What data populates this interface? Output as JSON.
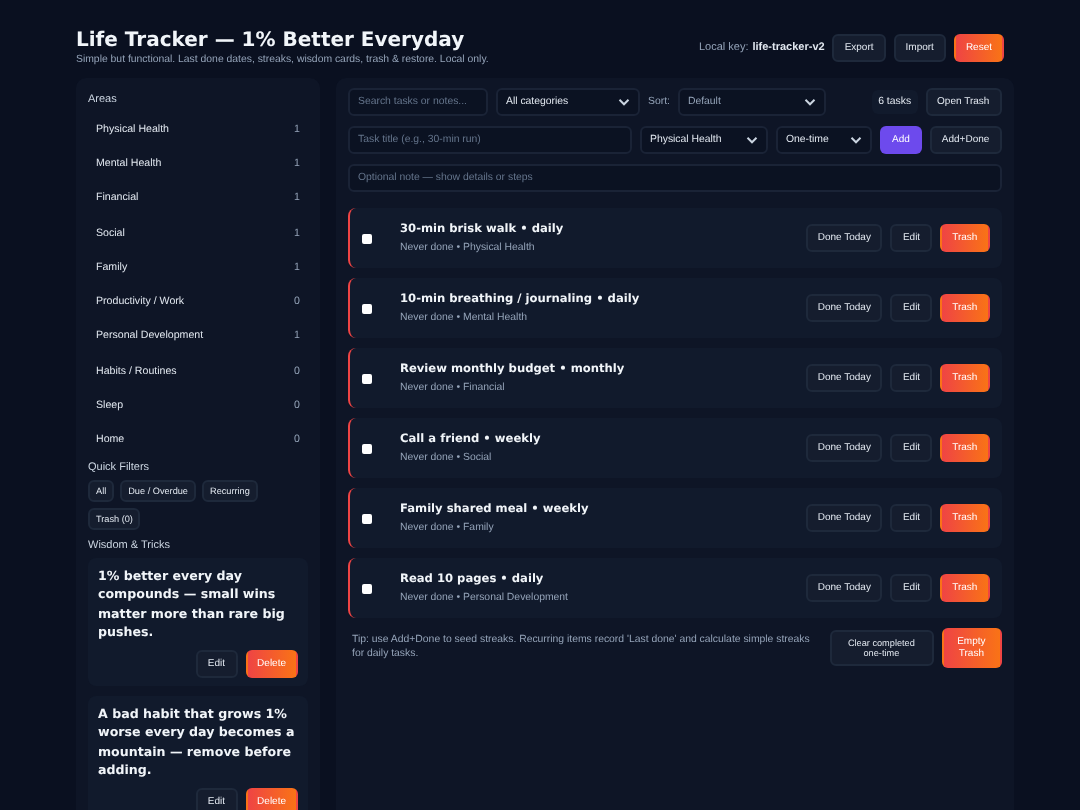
{
  "header": {
    "title": "Life Tracker — 1% Better Everyday",
    "subtitle": "Simple but functional. Last done dates, streaks, wisdom cards, trash & restore. Local only.",
    "key_label": "Local key:",
    "key_value": "life-tracker-v2",
    "buttons": [
      {
        "label": "Export",
        "kind": "plain"
      },
      {
        "label": "Import",
        "kind": "plain"
      },
      {
        "label": "Reset",
        "kind": "danger"
      }
    ]
  },
  "areas": {
    "title": "Areas",
    "items": [
      {
        "name": "Physical Health",
        "count": "1"
      },
      {
        "name": "Mental Health",
        "count": "1"
      },
      {
        "name": "Financial",
        "count": "1"
      },
      {
        "name": "Social",
        "count": "1"
      },
      {
        "name": "Family",
        "count": "1"
      },
      {
        "name": "Productivity / Work",
        "count": "0"
      },
      {
        "name": "Personal Development",
        "count": "1"
      },
      {
        "name": "Habits / Routines",
        "count": "0"
      },
      {
        "name": "Sleep",
        "count": "0"
      },
      {
        "name": "Home",
        "count": "0"
      }
    ]
  },
  "quick_filters": {
    "title": "Quick Filters",
    "items": [
      "All",
      "Due / Overdue",
      "Recurring",
      "Trash (0)"
    ]
  },
  "wisdom": {
    "title": "Wisdom & Tricks",
    "cards": [
      {
        "text": "1% better every day compounds — small wins matter more than rare big pushes.",
        "edit": "Edit",
        "delete": "Delete"
      },
      {
        "text": "A bad habit that grows 1% worse every day becomes a mountain — remove before adding.",
        "edit": "Edit",
        "delete": "Delete"
      }
    ]
  },
  "toolbar": {
    "search_placeholder": "Search tasks or notes...",
    "category": "All categories",
    "sort_label": "Sort:",
    "sort": "Default",
    "count": "6 tasks",
    "open_trash": "Open Trash"
  },
  "add_form": {
    "title_placeholder": "Task title (e.g., 30-min run)",
    "category": "Physical Health",
    "frequency": "One-time",
    "add": "Add",
    "add_done": "Add+Done",
    "note_placeholder": "Optional note — show details or steps"
  },
  "tasks": [
    {
      "title": "30-min brisk walk • daily",
      "meta": "Never done • Physical Health",
      "checked": false,
      "due": true,
      "done_today": "Done Today",
      "edit": "Edit",
      "trash": "Trash"
    },
    {
      "title": "10-min breathing / journaling • daily",
      "meta": "Never done • Mental Health",
      "checked": false,
      "due": true,
      "done_today": "Done Today",
      "edit": "Edit",
      "trash": "Trash"
    },
    {
      "title": "Review monthly budget • monthly",
      "meta": "Never done • Financial",
      "checked": false,
      "due": true,
      "done_today": "Done Today",
      "edit": "Edit",
      "trash": "Trash"
    },
    {
      "title": "Call a friend • weekly",
      "meta": "Never done • Social",
      "checked": false,
      "due": true,
      "done_today": "Done Today",
      "edit": "Edit",
      "trash": "Trash"
    },
    {
      "title": "Family shared meal • weekly",
      "meta": "Never done • Family",
      "checked": false,
      "due": true,
      "done_today": "Done Today",
      "edit": "Edit",
      "trash": "Trash"
    },
    {
      "title": "Read 10 pages • daily",
      "meta": "Never done • Personal Development",
      "checked": false,
      "due": true,
      "done_today": "Done Today",
      "edit": "Edit",
      "trash": "Trash"
    }
  ],
  "footer": {
    "tip": "Tip: use Add+Done to seed streaks. Recurring items record 'Last done' and calculate simple streaks for daily tasks.",
    "clear": "Clear completed one-time",
    "empty_trash": "Empty Trash"
  }
}
